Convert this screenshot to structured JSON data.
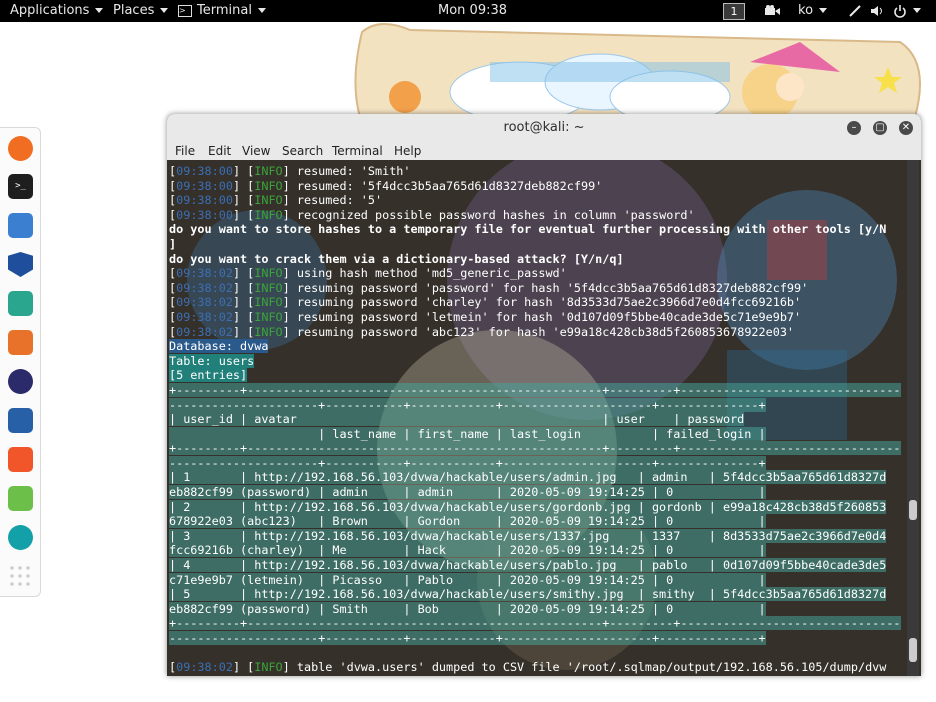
{
  "topbar": {
    "applications": "Applications",
    "places": "Places",
    "terminal": "Terminal",
    "clock": "Mon 09:38",
    "workspace": "1",
    "keyboard": "ko"
  },
  "dock": {
    "icons": [
      "firefox-icon",
      "terminal-icon",
      "files-icon",
      "metasploit-icon",
      "armitage-icon",
      "burpsuite-icon",
      "maltego-icon",
      "beef-icon",
      "faraday-icon",
      "leafpad-icon",
      "cutycapt-icon",
      "show-apps-icon"
    ]
  },
  "window": {
    "title": "root@kali: ~",
    "menu": [
      "File",
      "Edit",
      "View",
      "Search",
      "Terminal",
      "Help"
    ]
  },
  "terminal": {
    "lines": [
      [
        {
          "t": "[",
          "c": ""
        },
        {
          "t": "09:38:00",
          "c": "ts"
        },
        {
          "t": "] [",
          "c": ""
        },
        {
          "t": "INFO",
          "c": "info"
        },
        {
          "t": "] resumed: 'Smith'",
          "c": ""
        }
      ],
      [
        {
          "t": "[",
          "c": ""
        },
        {
          "t": "09:38:00",
          "c": "ts"
        },
        {
          "t": "] [",
          "c": ""
        },
        {
          "t": "INFO",
          "c": "info"
        },
        {
          "t": "] resumed: '5f4dcc3b5aa765d61d8327deb882cf99'",
          "c": ""
        }
      ],
      [
        {
          "t": "[",
          "c": ""
        },
        {
          "t": "09:38:00",
          "c": "ts"
        },
        {
          "t": "] [",
          "c": ""
        },
        {
          "t": "INFO",
          "c": "info"
        },
        {
          "t": "] resumed: '5'",
          "c": ""
        }
      ],
      [
        {
          "t": "[",
          "c": ""
        },
        {
          "t": "09:38:00",
          "c": "ts"
        },
        {
          "t": "] [",
          "c": ""
        },
        {
          "t": "INFO",
          "c": "info"
        },
        {
          "t": "] recognized possible password hashes in column 'password'",
          "c": ""
        }
      ],
      [
        {
          "t": "do you want to store hashes to a temporary file for eventual further processing with other tools [y/N",
          "c": "bold"
        }
      ],
      [
        {
          "t": "]",
          "c": "bold"
        }
      ],
      [
        {
          "t": "do you want to crack them via a dictionary-based attack? [Y/n/q]",
          "c": "bold"
        }
      ],
      [
        {
          "t": "[",
          "c": ""
        },
        {
          "t": "09:38:02",
          "c": "ts"
        },
        {
          "t": "] [",
          "c": ""
        },
        {
          "t": "INFO",
          "c": "info"
        },
        {
          "t": "] using hash method 'md5_generic_passwd'",
          "c": ""
        }
      ],
      [
        {
          "t": "[",
          "c": ""
        },
        {
          "t": "09:38:02",
          "c": "ts"
        },
        {
          "t": "] [",
          "c": ""
        },
        {
          "t": "INFO",
          "c": "info"
        },
        {
          "t": "] resuming password 'password' for hash '5f4dcc3b5aa765d61d8327deb882cf99'",
          "c": ""
        }
      ],
      [
        {
          "t": "[",
          "c": ""
        },
        {
          "t": "09:38:02",
          "c": "ts"
        },
        {
          "t": "] [",
          "c": ""
        },
        {
          "t": "INFO",
          "c": "info"
        },
        {
          "t": "] resuming password 'charley' for hash '8d3533d75ae2c3966d7e0d4fcc69216b'",
          "c": ""
        }
      ],
      [
        {
          "t": "[",
          "c": ""
        },
        {
          "t": "09:38:02",
          "c": "ts"
        },
        {
          "t": "] [",
          "c": ""
        },
        {
          "t": "INFO",
          "c": "info"
        },
        {
          "t": "] resuming password 'letmein' for hash '0d107d09f5bbe40cade3de5c71e9e9b7'",
          "c": ""
        }
      ],
      [
        {
          "t": "[",
          "c": ""
        },
        {
          "t": "09:38:02",
          "c": "ts"
        },
        {
          "t": "] [",
          "c": ""
        },
        {
          "t": "INFO",
          "c": "info"
        },
        {
          "t": "] resuming password 'abc123' for hash 'e99a18c428cb38d5f260853678922e03'",
          "c": ""
        }
      ],
      [
        {
          "t": "Database: dvwa",
          "c": "hl-blue"
        }
      ],
      [
        {
          "t": "Table: users",
          "c": "hl-cyan"
        }
      ],
      [
        {
          "t": "[5 entries]",
          "c": "hl-cyan"
        }
      ],
      [
        {
          "t": "+---------+--------------------------------------------------+---------+-------------------------------",
          "c": "tbl"
        }
      ],
      [
        {
          "t": "---------------------+-----------+------------+---------------------+--------------+",
          "c": "tbl"
        }
      ],
      [
        {
          "t": "| user_id | avatar                                           | user    | password",
          "c": "tbl"
        }
      ],
      [
        {
          "t": "                     | last_name | first_name | last_login          | failed_login |",
          "c": "tbl"
        }
      ],
      [
        {
          "t": "+---------+--------------------------------------------------+---------+-------------------------------",
          "c": "tbl"
        }
      ],
      [
        {
          "t": "---------------------+-----------+------------+---------------------+--------------+",
          "c": "tbl"
        }
      ],
      [
        {
          "t": "| 1       | http://192.168.56.103/dvwa/hackable/users/admin.jpg   | admin   | 5f4dcc3b5aa765d61d8327d",
          "c": "tbl"
        }
      ],
      [
        {
          "t": "eb882cf99 (password) | admin     | admin      | 2020-05-09 19:14:25 | 0            |",
          "c": "tbl"
        }
      ],
      [
        {
          "t": "| 2       | http://192.168.56.103/dvwa/hackable/users/gordonb.jpg | gordonb | e99a18c428cb38d5f260853",
          "c": "tbl"
        }
      ],
      [
        {
          "t": "678922e03 (abc123)   | Brown     | Gordon     | 2020-05-09 19:14:25 | 0            |",
          "c": "tbl"
        }
      ],
      [
        {
          "t": "| 3       | http://192.168.56.103/dvwa/hackable/users/1337.jpg    | 1337    | 8d3533d75ae2c3966d7e0d4",
          "c": "tbl"
        }
      ],
      [
        {
          "t": "fcc69216b (charley)  | Me        | Hack       | 2020-05-09 19:14:25 | 0            |",
          "c": "tbl"
        }
      ],
      [
        {
          "t": "| 4       | http://192.168.56.103/dvwa/hackable/users/pablo.jpg   | pablo   | 0d107d09f5bbe40cade3de5",
          "c": "tbl"
        }
      ],
      [
        {
          "t": "c71e9e9b7 (letmein)  | Picasso   | Pablo      | 2020-05-09 19:14:25 | 0            |",
          "c": "tbl"
        }
      ],
      [
        {
          "t": "| 5       | http://192.168.56.103/dvwa/hackable/users/smithy.jpg  | smithy  | 5f4dcc3b5aa765d61d8327d",
          "c": "tbl"
        }
      ],
      [
        {
          "t": "eb882cf99 (password) | Smith     | Bob        | 2020-05-09 19:14:25 | 0            |",
          "c": "tbl"
        }
      ],
      [
        {
          "t": "+---------+--------------------------------------------------+---------+-------------------------------",
          "c": "tbl"
        }
      ],
      [
        {
          "t": "---------------------+-----------+------------+---------------------+--------------+",
          "c": "tbl"
        }
      ],
      [
        {
          "t": "",
          "c": ""
        }
      ],
      [
        {
          "t": "[",
          "c": ""
        },
        {
          "t": "09:38:02",
          "c": "ts"
        },
        {
          "t": "] [",
          "c": ""
        },
        {
          "t": "INFO",
          "c": "info"
        },
        {
          "t": "] table 'dvwa.users' dumped to CSV file '/root/.sqlmap/output/192.168.56.105/dump/dvw",
          "c": ""
        }
      ]
    ]
  }
}
